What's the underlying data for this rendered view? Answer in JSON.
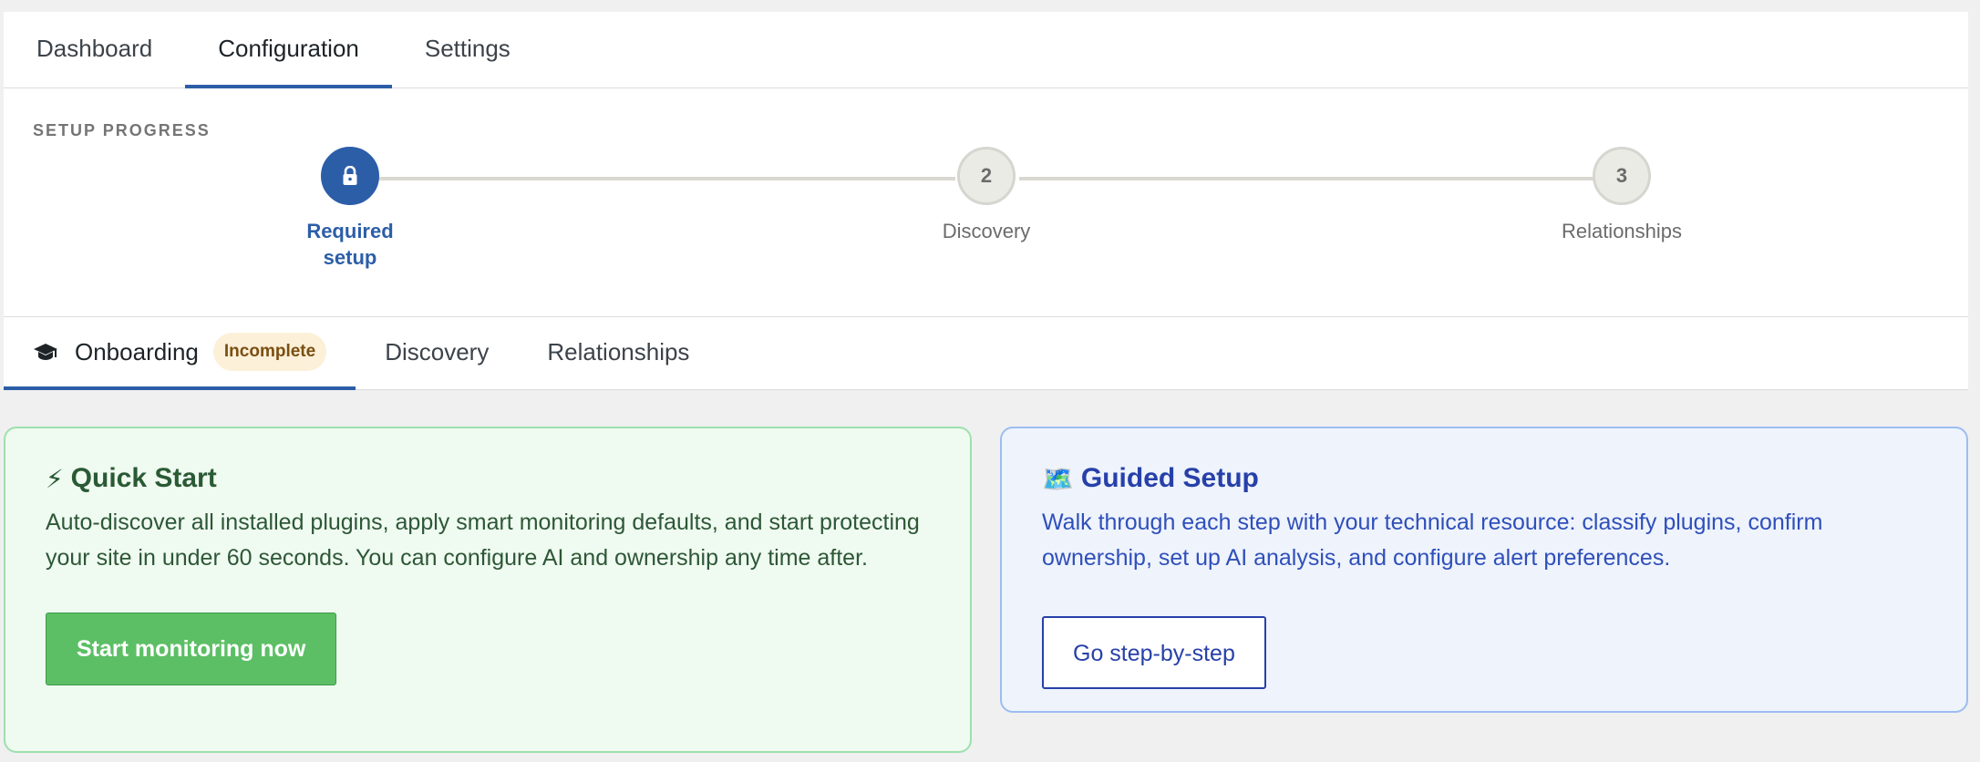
{
  "top_tabs": [
    {
      "label": "Dashboard",
      "active": false
    },
    {
      "label": "Configuration",
      "active": true
    },
    {
      "label": "Settings",
      "active": false
    }
  ],
  "progress": {
    "title": "SETUP PROGRESS",
    "steps": [
      {
        "label": "Required setup",
        "marker_icon": "lock-icon",
        "active": true
      },
      {
        "label": "Discovery",
        "marker": "2",
        "active": false
      },
      {
        "label": "Relationships",
        "marker": "3",
        "active": false
      }
    ]
  },
  "sub_tabs": {
    "onboarding": {
      "label": "Onboarding",
      "icon": "graduation-cap-icon",
      "badge": "Incomplete",
      "active": true
    },
    "discovery": {
      "label": "Discovery"
    },
    "relationships": {
      "label": "Relationships"
    }
  },
  "quick_start": {
    "emoji": "⚡",
    "title": "Quick Start",
    "body": "Auto-discover all installed plugins, apply smart monitoring defaults, and start protecting your site in under 60 seconds. You can configure AI and ownership any time after.",
    "button": "Start monitoring now"
  },
  "guided_setup": {
    "emoji": "🗺️",
    "title": "Guided Setup",
    "body": "Walk through each step with your technical resource: classify plugins, confirm ownership, set up AI analysis, and configure alert preferences.",
    "button": "Go step-by-step"
  },
  "colors": {
    "accent": "#2c5ea8",
    "quick_start_bg": "#effaf1",
    "quick_start_button": "#5cbf65",
    "guided_bg": "#eef3fc",
    "guided_text": "#2740a8",
    "badge_bg": "#fcf0d9"
  }
}
